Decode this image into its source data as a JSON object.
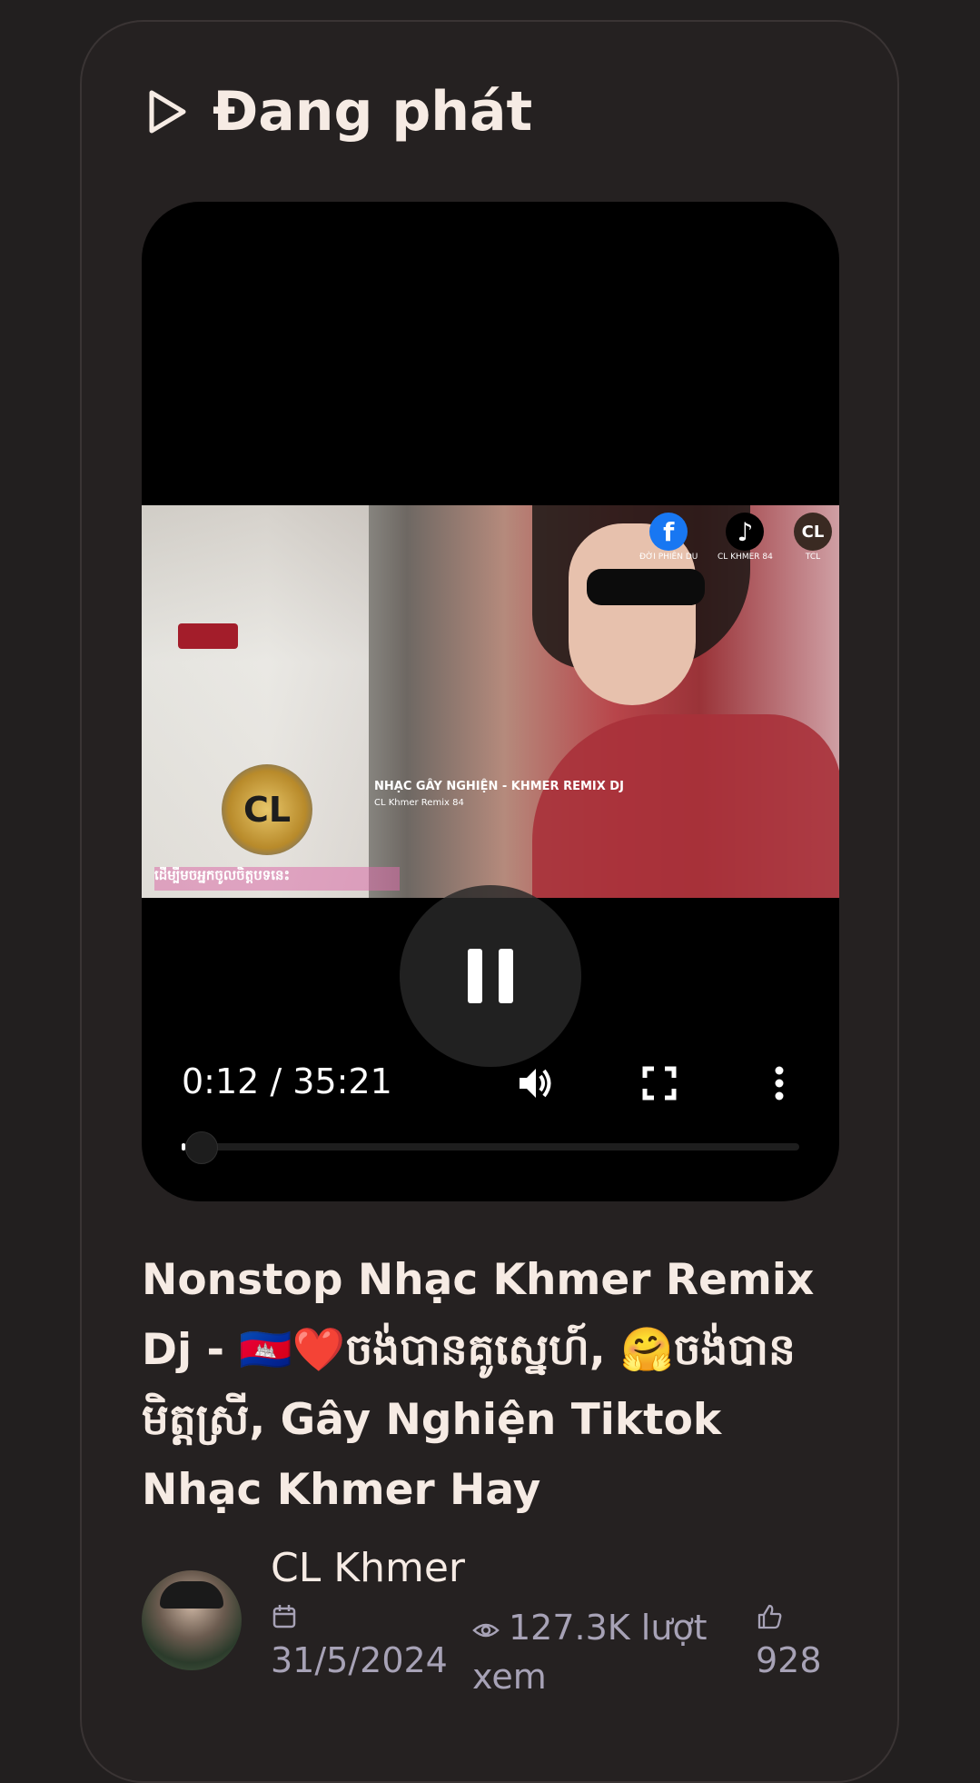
{
  "header": {
    "title": "Đang phát"
  },
  "video": {
    "overlay": {
      "social": [
        {
          "symbol": "f",
          "caption": "ĐỜI PHIÊN DU",
          "color": "#1877f2"
        },
        {
          "symbol": "♪",
          "caption": "CL KHMER 84",
          "color": "#000000"
        },
        {
          "symbol": "CL",
          "caption": "TCL",
          "color": "#3a2a22"
        }
      ],
      "logo_text": "CL",
      "caption": "NHẠC GÂY NGHIỆN - KHMER REMIX DJ",
      "subcaption": "CL Khmer Remix 84",
      "bottom_text": "ដើម្បីមចអ្នកចូលចិត្តបទនេះ"
    },
    "time_display": "0:12 / 35:21",
    "progress": 0.006,
    "state": "playing"
  },
  "details": {
    "title": "Nonstop Nhạc Khmer Remix Dj - 🇰🇭❤️ចង់បានគូស្នេហ៍, 🤗ចង់បានមិត្តស្រី, Gây Nghiện Tiktok Nhạc Khmer Hay",
    "channel": "CL Khmer",
    "date": "31/5/2024",
    "views": "127.3K lượt xem",
    "likes": "928"
  },
  "colors": {
    "background": "#221f1f",
    "text": "#f6ebe4",
    "muted": "#a7a2b6"
  },
  "icons": [
    "play-icon",
    "pause-icon",
    "volume-icon",
    "fullscreen-icon",
    "more-vertical-icon",
    "calendar-icon",
    "eye-icon",
    "thumbs-up-icon"
  ]
}
